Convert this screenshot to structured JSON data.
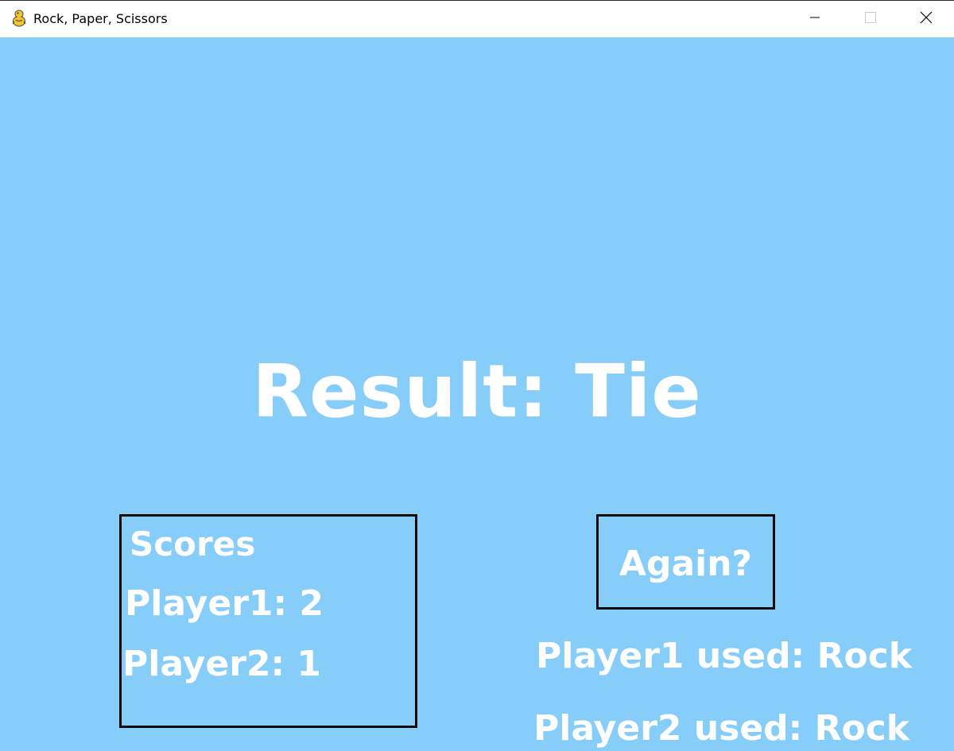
{
  "window": {
    "title": "Rock, Paper, Scissors",
    "icon": "pygame-snake-icon",
    "controls": {
      "minimize_icon": "minimize-icon",
      "maximize_icon": "maximize-icon",
      "close_icon": "close-icon"
    }
  },
  "game": {
    "background_color": "#87cdf9",
    "text_color": "#ffffff",
    "result_text": "Result: Tie",
    "scores": {
      "title": "Scores",
      "player1": "Player1: 2",
      "player2": "Player2: 1"
    },
    "again_button_label": "Again?",
    "player1_used": "Player1 used: Rock",
    "player2_used": "Player2 used: Rock"
  }
}
